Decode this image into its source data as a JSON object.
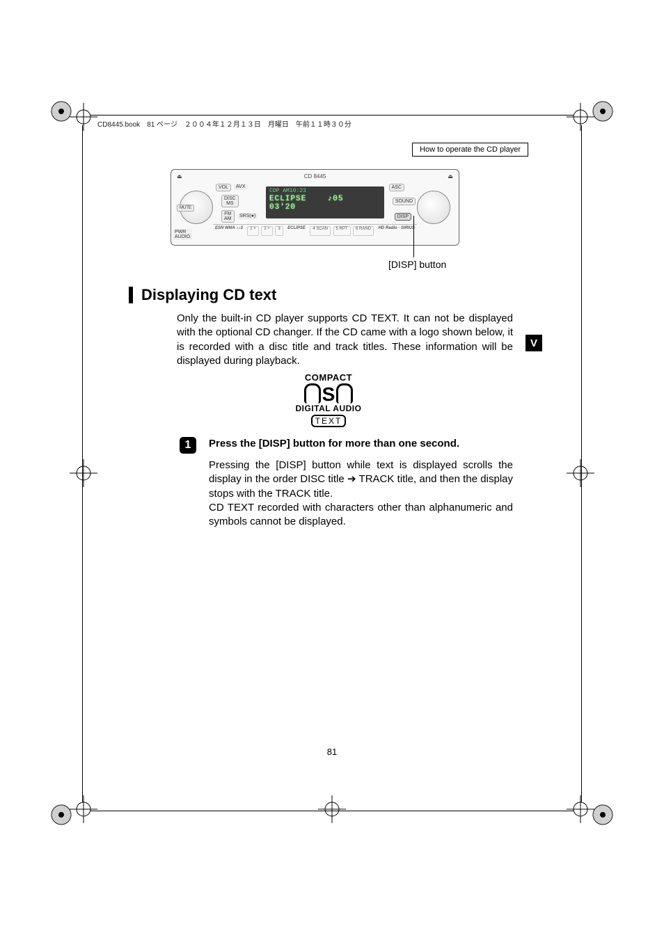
{
  "meta_header": "CD8445.book　81 ページ　２００４年１２月１３日　月曜日　午前１１時３０分",
  "breadcrumb": "How to operate the CD player",
  "device": {
    "model": "CD 8445",
    "screen_line1": "CDP           AM10:23",
    "screen_line2_left": "ECLIPSE",
    "screen_line2_right": "03'20",
    "screen_sub": "♪05",
    "btn_vol": "VOL",
    "btn_avx": "AVX",
    "btn_disc": "DISC\nMS",
    "btn_fm": "FM\nAM",
    "btn_srs": "SRS(●)",
    "btn_asc": "ASC",
    "btn_sound": "SOUND",
    "btn_disp": "DISP",
    "btn_mute": "MUTE",
    "btn_pwr": "PWR\nAUDIO",
    "strip_esn": "ESN WMA ♪♪3",
    "strip_1": "1   ˅",
    "strip_2": "2   ˄",
    "strip_3": "3",
    "strip_eclipse": "ECLIPSE",
    "strip_4": "4 SCAN",
    "strip_5": "5  RPT",
    "strip_6": "6 RAND",
    "strip_hd": "HD Radio · SIRIUS"
  },
  "callout_disp": "[DISP] button",
  "section_heading": "Displaying CD text",
  "intro_paragraph": "Only the built-in CD player supports CD TEXT. It can not be displayed with the optional CD changer. If the CD came with a logo shown below, it is recorded with a disc title and track titles. These information will be displayed during playback.",
  "side_tab": "V",
  "cd_logo": {
    "compact": "COMPACT",
    "digital_audio": "DIGITAL AUDIO",
    "text": "TEXT"
  },
  "step": {
    "number": "1",
    "heading": "Press the [DISP] button for more than one second.",
    "paragraph": "Pressing the [DISP] button while text is displayed scrolls the display in the order DISC title ➔ TRACK title, and then the display stops with the TRACK title.\nCD TEXT recorded with characters other than alphanumeric and symbols cannot be displayed."
  },
  "page_number": "81"
}
